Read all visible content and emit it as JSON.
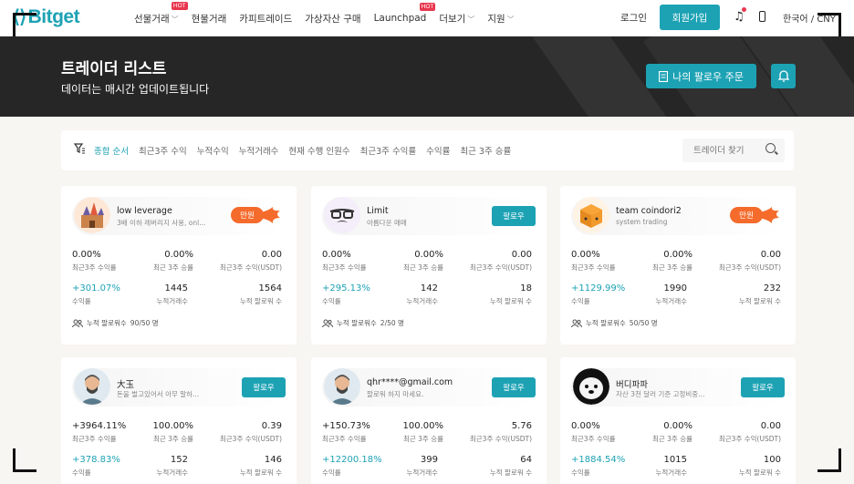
{
  "nav": {
    "logo": "Bitget",
    "items": [
      {
        "label": "선물거래",
        "chevron": true,
        "hot": "HOT"
      },
      {
        "label": "현물거래",
        "chevron": false,
        "hot": ""
      },
      {
        "label": "카피트레이드",
        "chevron": false,
        "hot": ""
      },
      {
        "label": "가상자산 구매",
        "chevron": false,
        "hot": ""
      },
      {
        "label": "Launchpad",
        "chevron": false,
        "hot": "HOT"
      },
      {
        "label": "더보기",
        "chevron": true,
        "hot": ""
      },
      {
        "label": "지원",
        "chevron": true,
        "hot": ""
      }
    ],
    "login": "로그인",
    "signup": "회원가입",
    "language": "한국어 / CNY"
  },
  "hero": {
    "title": "트레이더 리스트",
    "subtitle": "데이터는 매시간 업데이트됩니다",
    "my_orders": "나의 팔로우 주문"
  },
  "filters": {
    "sorts": [
      "종합 순서",
      "최근3주 수익",
      "누적수익",
      "누적거래수",
      "현재 수행 인원수",
      "최근3주 수익률",
      "수익률",
      "최근 3주 승률"
    ],
    "search_placeholder": "트레이더 찾기"
  },
  "labels": {
    "roi3w": "최근3주 수익률",
    "win3w": "최근 3주 승률",
    "profit3w": "최근3주 수익(USDT)",
    "roi": "수익률",
    "trades": "누적거래수",
    "followers": "누적 팔로워 수",
    "follow": "팔로우",
    "full": "만원",
    "follower_prefix": "누적 팔로워수"
  },
  "traders": [
    {
      "name": "low leverage",
      "desc": "3배 이하 레버리지 사용, onl...",
      "status": "full",
      "roi3w": "0.00%",
      "win3w": "0.00%",
      "profit3w": "0.00",
      "roi": "+301.07%",
      "trades": "1445",
      "followers": "1564",
      "follow_count": "90/50 명",
      "avatar": "castle-avatar"
    },
    {
      "name": "Limit",
      "desc": "아름다운 매매",
      "status": "follow",
      "roi3w": "0.00%",
      "win3w": "0.00%",
      "profit3w": "0.00",
      "roi": "+295.13%",
      "trades": "142",
      "followers": "18",
      "follow_count": "2/50 명",
      "avatar": "glasses-avatar"
    },
    {
      "name": "team coindori2",
      "desc": "system trading",
      "status": "full",
      "roi3w": "0.00%",
      "win3w": "0.00%",
      "profit3w": "0.00",
      "roi": "+1129.99%",
      "trades": "1990",
      "followers": "232",
      "follow_count": "50/50 명",
      "avatar": "box-avatar"
    },
    {
      "name": "大玉",
      "desc": "돈을 벌고있어서 아무 말하...",
      "status": "follow",
      "roi3w": "+3964.11%",
      "win3w": "100.00%",
      "profit3w": "0.39",
      "roi": "+378.83%",
      "trades": "152",
      "followers": "146",
      "avatar": "man-avatar"
    },
    {
      "name": "qhr****@gmail.com",
      "desc": "팔로워 하지 마세요.",
      "status": "follow",
      "roi3w": "+150.73%",
      "win3w": "100.00%",
      "profit3w": "5.76",
      "roi": "+12200.18%",
      "trades": "399",
      "followers": "64",
      "avatar": "man-avatar"
    },
    {
      "name": "버디파파",
      "desc": "자산 3천 달러 기준 고정비중...",
      "status": "follow",
      "roi3w": "0.00%",
      "win3w": "0.00%",
      "profit3w": "0.00",
      "roi": "+1884.54%",
      "trades": "1015",
      "followers": "100",
      "avatar": "dog-avatar"
    }
  ],
  "colors": {
    "accent": "#1da2b4",
    "hot": "#e8364e",
    "full": "#f46b2c",
    "hero_bg": "#262626"
  }
}
